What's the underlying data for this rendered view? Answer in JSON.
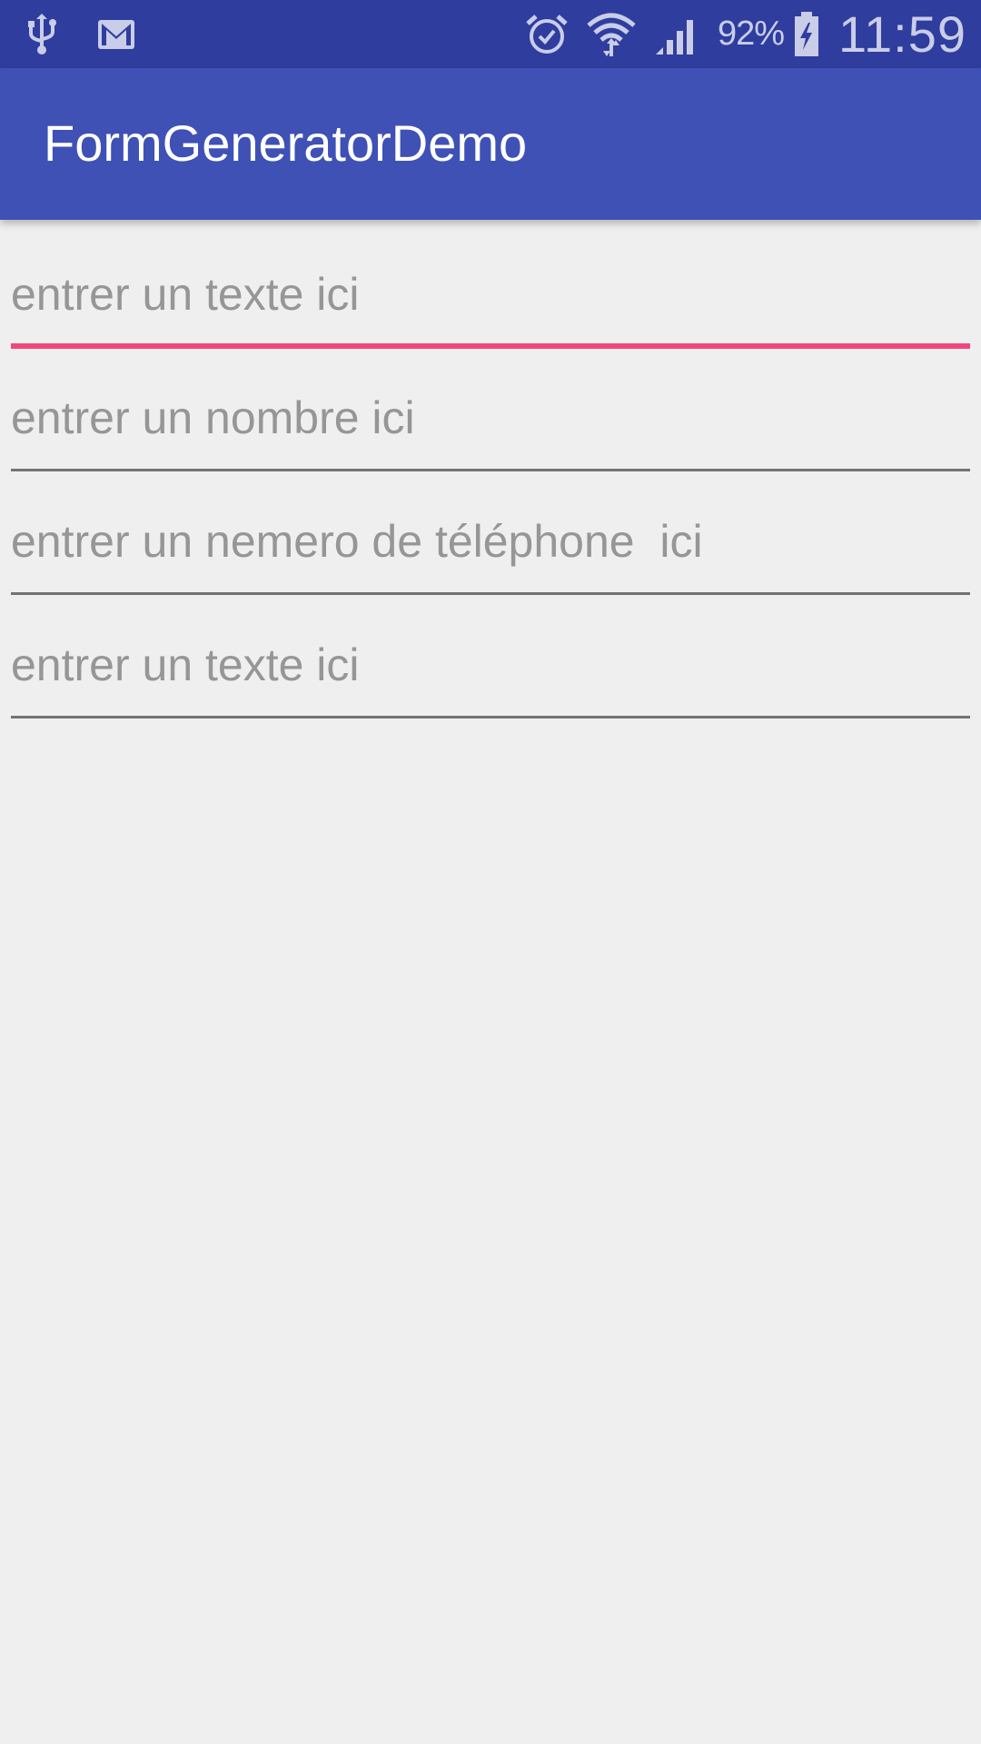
{
  "status_bar": {
    "left_icons": [
      "usb-icon",
      "gmail-icon"
    ],
    "right_icons": [
      "alarm-icon",
      "wifi-icon",
      "signal-icon",
      "battery-charging-icon"
    ],
    "battery_percent": "92%",
    "time": "11:59"
  },
  "app_bar": {
    "title": "FormGeneratorDemo",
    "color": "#3f51b5"
  },
  "form": {
    "fields": [
      {
        "placeholder": "entrer un texte ici",
        "value": "",
        "focused": true
      },
      {
        "placeholder": "entrer un nombre ici",
        "value": "",
        "focused": false
      },
      {
        "placeholder": "entrer un nemero de téléphone  ici",
        "value": "",
        "focused": false
      },
      {
        "placeholder": "entrer un texte ici",
        "value": "",
        "focused": false
      }
    ],
    "accent_color": "#f0477c"
  }
}
